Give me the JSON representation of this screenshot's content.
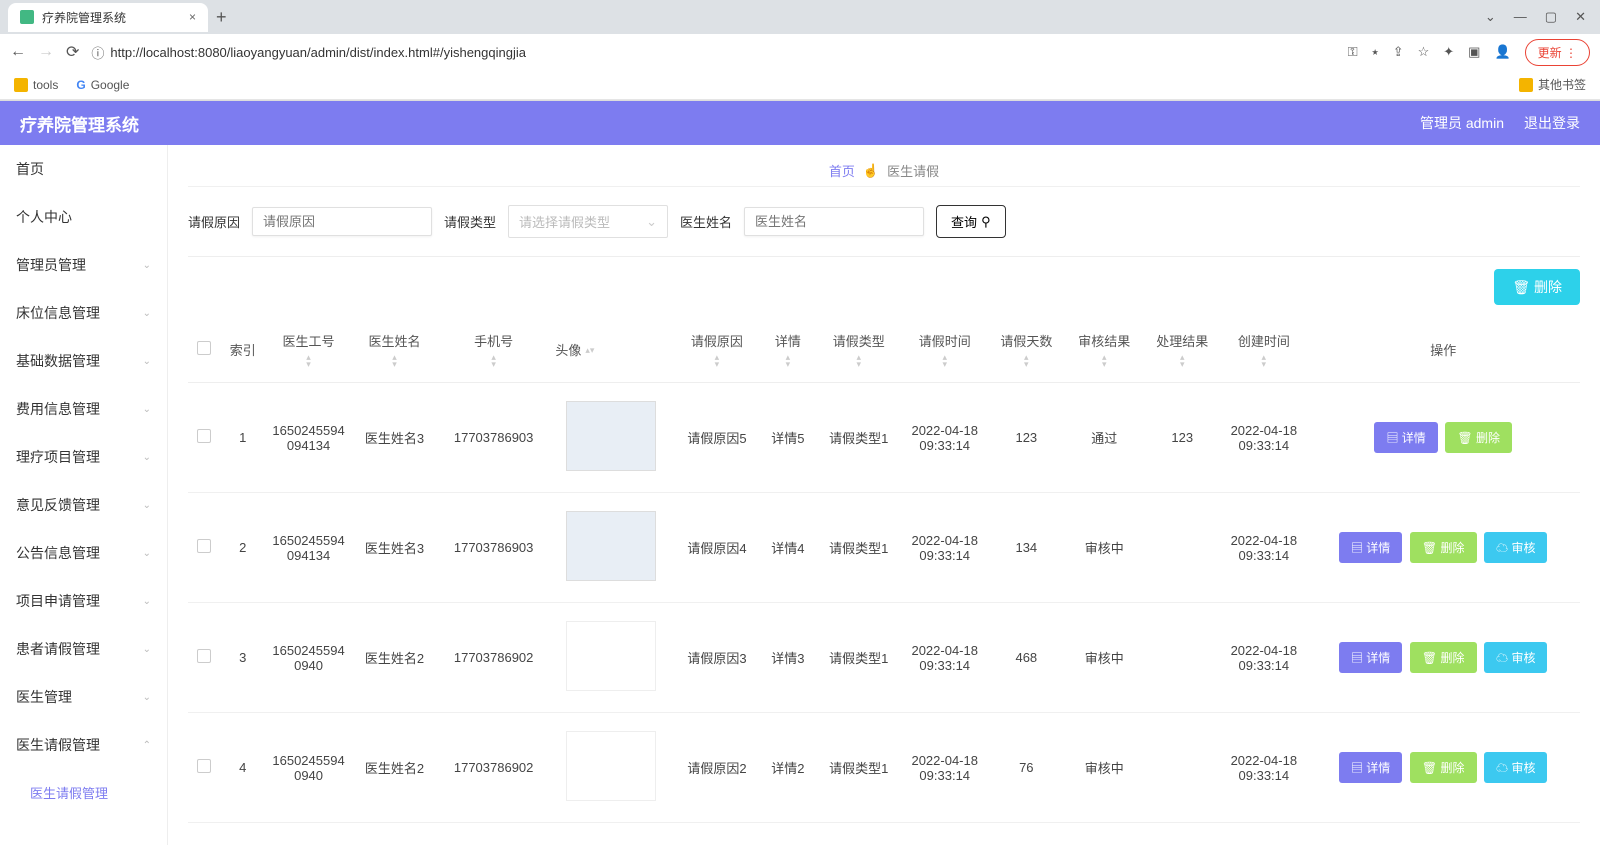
{
  "browser": {
    "tab_title": "疗养院管理系统",
    "url": "http://localhost:8080/liaoyangyuan/admin/dist/index.html#/yishengqingjia",
    "update_label": "更新",
    "bookmarks": {
      "tools": "tools",
      "google": "Google",
      "other": "其他书签"
    }
  },
  "header": {
    "app_title": "疗养院管理系统",
    "user_label": "管理员 admin",
    "logout_label": "退出登录"
  },
  "sidebar": {
    "items": [
      {
        "label": "首页"
      },
      {
        "label": "个人中心"
      },
      {
        "label": "管理员管理"
      },
      {
        "label": "床位信息管理"
      },
      {
        "label": "基础数据管理"
      },
      {
        "label": "费用信息管理"
      },
      {
        "label": "理疗项目管理"
      },
      {
        "label": "意见反馈管理"
      },
      {
        "label": "公告信息管理"
      },
      {
        "label": "项目申请管理"
      },
      {
        "label": "患者请假管理"
      },
      {
        "label": "医生管理"
      },
      {
        "label": "医生请假管理"
      }
    ],
    "sub_active": "医生请假管理"
  },
  "breadcrumb": {
    "home": "首页",
    "current": "医生请假"
  },
  "filters": {
    "reason_label": "请假原因",
    "reason_placeholder": "请假原因",
    "type_label": "请假类型",
    "type_placeholder": "请选择请假类型",
    "name_label": "医生姓名",
    "name_placeholder": "医生姓名",
    "query_btn": "查询"
  },
  "toolbar": {
    "delete_btn": "删除"
  },
  "table": {
    "headers": {
      "index": "索引",
      "doctor_id": "医生工号",
      "doctor_name": "医生姓名",
      "phone": "手机号",
      "avatar": "头像",
      "reason": "请假原因",
      "detail": "详情",
      "type": "请假类型",
      "leave_time": "请假时间",
      "days": "请假天数",
      "audit_result": "审核结果",
      "process_result": "处理结果",
      "create_time": "创建时间",
      "ops": "操作"
    },
    "ops": {
      "detail": "详情",
      "delete": "删除",
      "audit": "审核"
    },
    "rows": [
      {
        "index": "1",
        "doctor_id": "1650245594094134",
        "doctor_name": "医生姓名3",
        "phone": "17703786903",
        "reason": "请假原因5",
        "detail": "详情5",
        "type": "请假类型1",
        "leave_time": "2022-04-18 09:33:14",
        "days": "123",
        "audit_result": "通过",
        "process_result": "123",
        "create_time": "2022-04-18 09:33:14",
        "has_audit": false
      },
      {
        "index": "2",
        "doctor_id": "1650245594094134",
        "doctor_name": "医生姓名3",
        "phone": "17703786903",
        "reason": "请假原因4",
        "detail": "详情4",
        "type": "请假类型1",
        "leave_time": "2022-04-18 09:33:14",
        "days": "134",
        "audit_result": "审核中",
        "process_result": "",
        "create_time": "2022-04-18 09:33:14",
        "has_audit": true
      },
      {
        "index": "3",
        "doctor_id": "16502455940940",
        "doctor_name": "医生姓名2",
        "phone": "17703786902",
        "reason": "请假原因3",
        "detail": "详情3",
        "type": "请假类型1",
        "leave_time": "2022-04-18 09:33:14",
        "days": "468",
        "audit_result": "审核中",
        "process_result": "",
        "create_time": "2022-04-18 09:33:14",
        "has_audit": true
      },
      {
        "index": "4",
        "doctor_id": "16502455940940",
        "doctor_name": "医生姓名2",
        "phone": "17703786902",
        "reason": "请假原因2",
        "detail": "详情2",
        "type": "请假类型1",
        "leave_time": "2022-04-18 09:33:14",
        "days": "76",
        "audit_result": "审核中",
        "process_result": "",
        "create_time": "2022-04-18 09:33:14",
        "has_audit": true
      }
    ]
  }
}
